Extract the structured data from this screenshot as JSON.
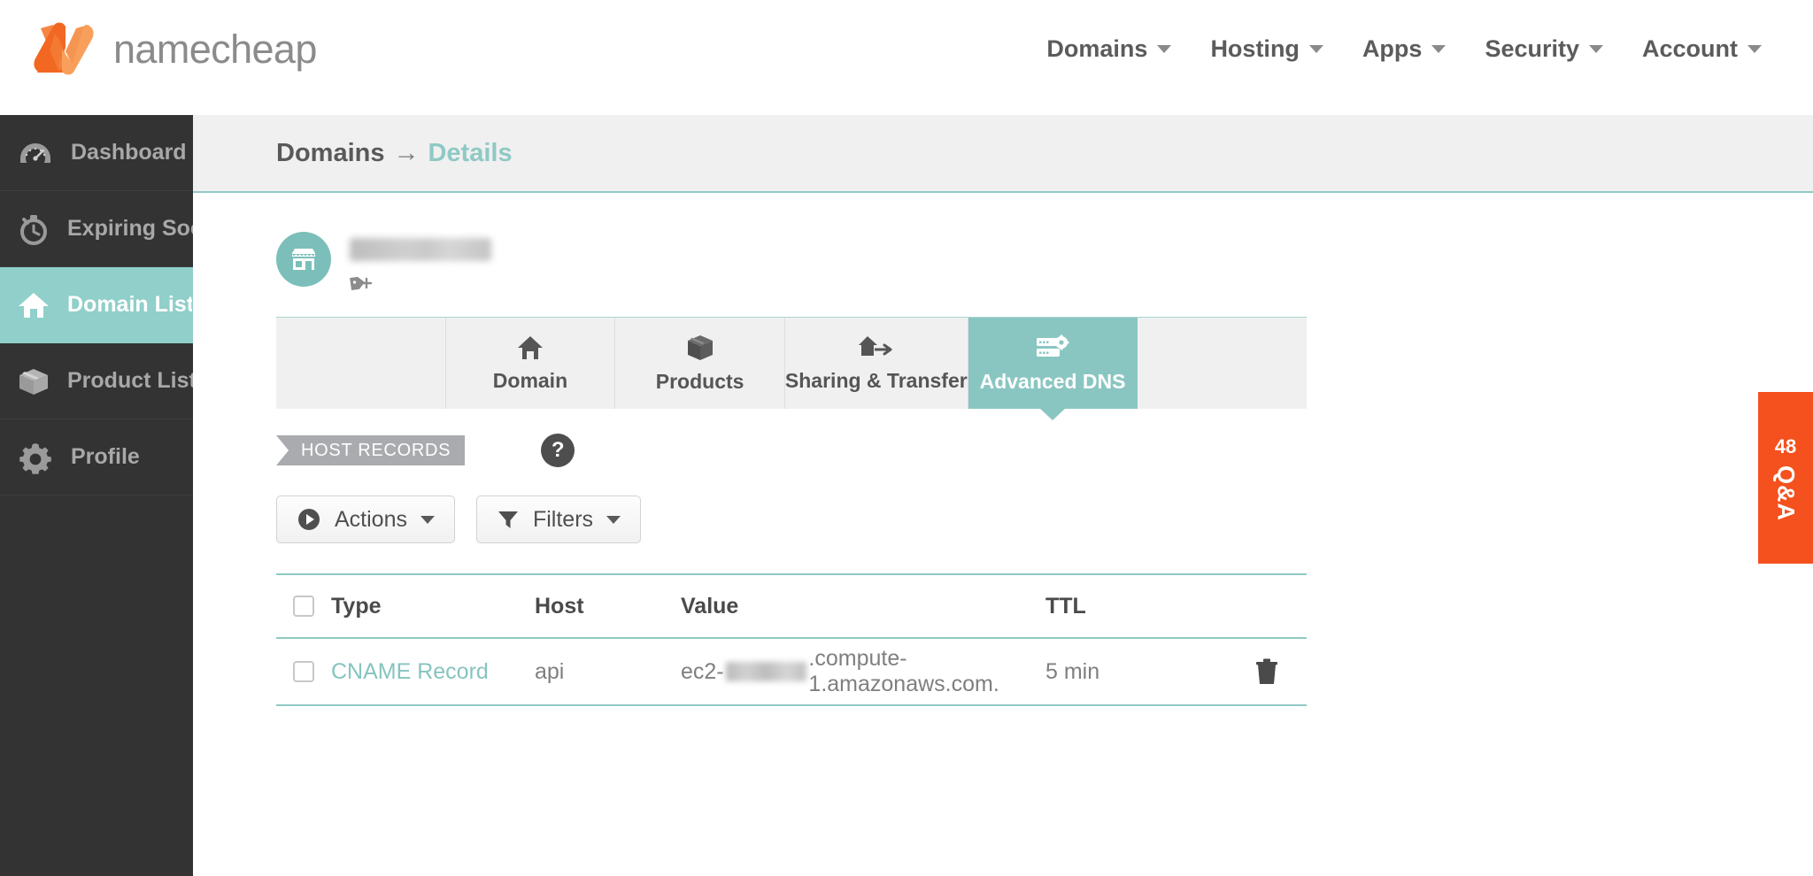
{
  "header": {
    "logo_text": "namecheap",
    "nav": [
      {
        "label": "Domains",
        "icon": "chevron-down-icon"
      },
      {
        "label": "Hosting",
        "icon": "chevron-down-icon"
      },
      {
        "label": "Apps",
        "icon": "chevron-down-icon"
      },
      {
        "label": "Security",
        "icon": "chevron-down-icon"
      },
      {
        "label": "Account",
        "icon": "chevron-down-icon"
      }
    ]
  },
  "sidebar": {
    "items": [
      {
        "label": "Dashboard",
        "icon": "gauge-icon",
        "active": false
      },
      {
        "label": "Expiring Soon",
        "icon": "stopwatch-icon",
        "active": false
      },
      {
        "label": "Domain List",
        "icon": "house-icon",
        "active": true
      },
      {
        "label": "Product List",
        "icon": "box-icon",
        "active": false
      },
      {
        "label": "Profile",
        "icon": "gear-icon",
        "active": false
      }
    ],
    "active_color": "#90cfca",
    "background_color": "#333333"
  },
  "breadcrumb": {
    "parent": "Domains",
    "separator": "→",
    "current": "Details"
  },
  "domain": {
    "avatar_icon": "storefront-icon",
    "name_redacted": true,
    "tag_icon": "tag-add-icon"
  },
  "tabs": [
    {
      "label": "",
      "icon": "",
      "active": false
    },
    {
      "label": "Domain",
      "icon": "house-icon",
      "active": false
    },
    {
      "label": "Products",
      "icon": "box-icon",
      "active": false
    },
    {
      "label": "Sharing & Transfer",
      "icon": "house-transfer-icon",
      "active": false
    },
    {
      "label": "Advanced DNS",
      "icon": "server-gear-icon",
      "active": true
    },
    {
      "label": "",
      "icon": "",
      "active": false
    }
  ],
  "section": {
    "ribbon_label": "HOST RECORDS",
    "help_label": "?"
  },
  "toolbar": {
    "actions_label": "Actions",
    "actions_icon": "play-circle-icon",
    "filters_label": "Filters",
    "filters_icon": "funnel-icon"
  },
  "table": {
    "columns": [
      "Type",
      "Host",
      "Value",
      "TTL"
    ],
    "rows": [
      {
        "type": "CNAME Record",
        "host": "api",
        "value_prefix": "ec2-",
        "value_redacted": true,
        "value_suffix": ".compute-1.amazonaws.com.",
        "ttl": "5 min",
        "delete_icon": "trash-icon"
      }
    ]
  },
  "qa_widget": {
    "badge": "48",
    "label": "Q&A",
    "color": "#f4511e"
  },
  "theme": {
    "accent_teal": "#8ac6c1",
    "accent_orange": "#f4511e",
    "dark_sidebar": "#333333"
  }
}
